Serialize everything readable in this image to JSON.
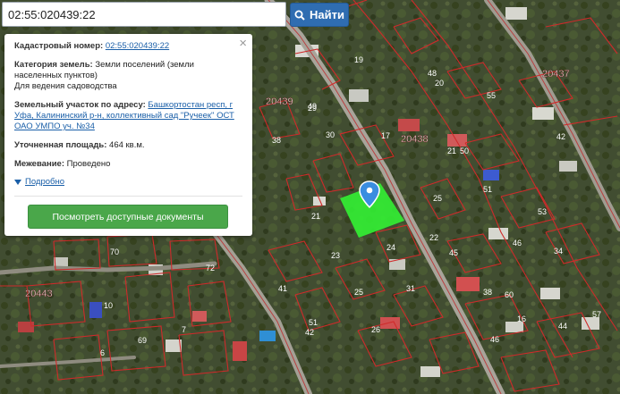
{
  "search": {
    "value": "02:55:020439:22",
    "button_label": "Найти"
  },
  "info": {
    "cad_label": "Кадастровый номер:",
    "cad_value": "02:55:020439:22",
    "category_label": "Категория земель:",
    "category_value": "Земли поселений (земли населенных пунктов)",
    "use_value": "Для ведения садоводства",
    "address_label": "Земельный участок по адресу:",
    "address_value": "Башкортостан респ, г Уфа, Калининский р-н, коллективный сад \"Ручеек\" ОСТ ОАО УМПО уч. №34",
    "area_label": "Уточненная площадь:",
    "area_value": "464 кв.м.",
    "survey_label": "Межевание:",
    "survey_value": "Проведено",
    "more_label": "Подробно",
    "docs_button": "Посмотреть доступные документы",
    "close_glyph": "×"
  },
  "map": {
    "parcel_color": "#33ee33",
    "boundary_color": "#cf2a2a",
    "block_labels": [
      "20439",
      "20438",
      "20437",
      "20443"
    ],
    "parcel_numbers": [
      "19",
      "48",
      "49",
      "20",
      "29",
      "55",
      "30",
      "17",
      "38",
      "21",
      "50",
      "42",
      "21",
      "51",
      "25",
      "24",
      "23",
      "53",
      "70",
      "72",
      "22",
      "45",
      "46",
      "41",
      "31",
      "34",
      "10",
      "7",
      "42",
      "25",
      "38",
      "26",
      "60",
      "16",
      "44",
      "69",
      "6",
      "51",
      "46",
      "57"
    ]
  }
}
